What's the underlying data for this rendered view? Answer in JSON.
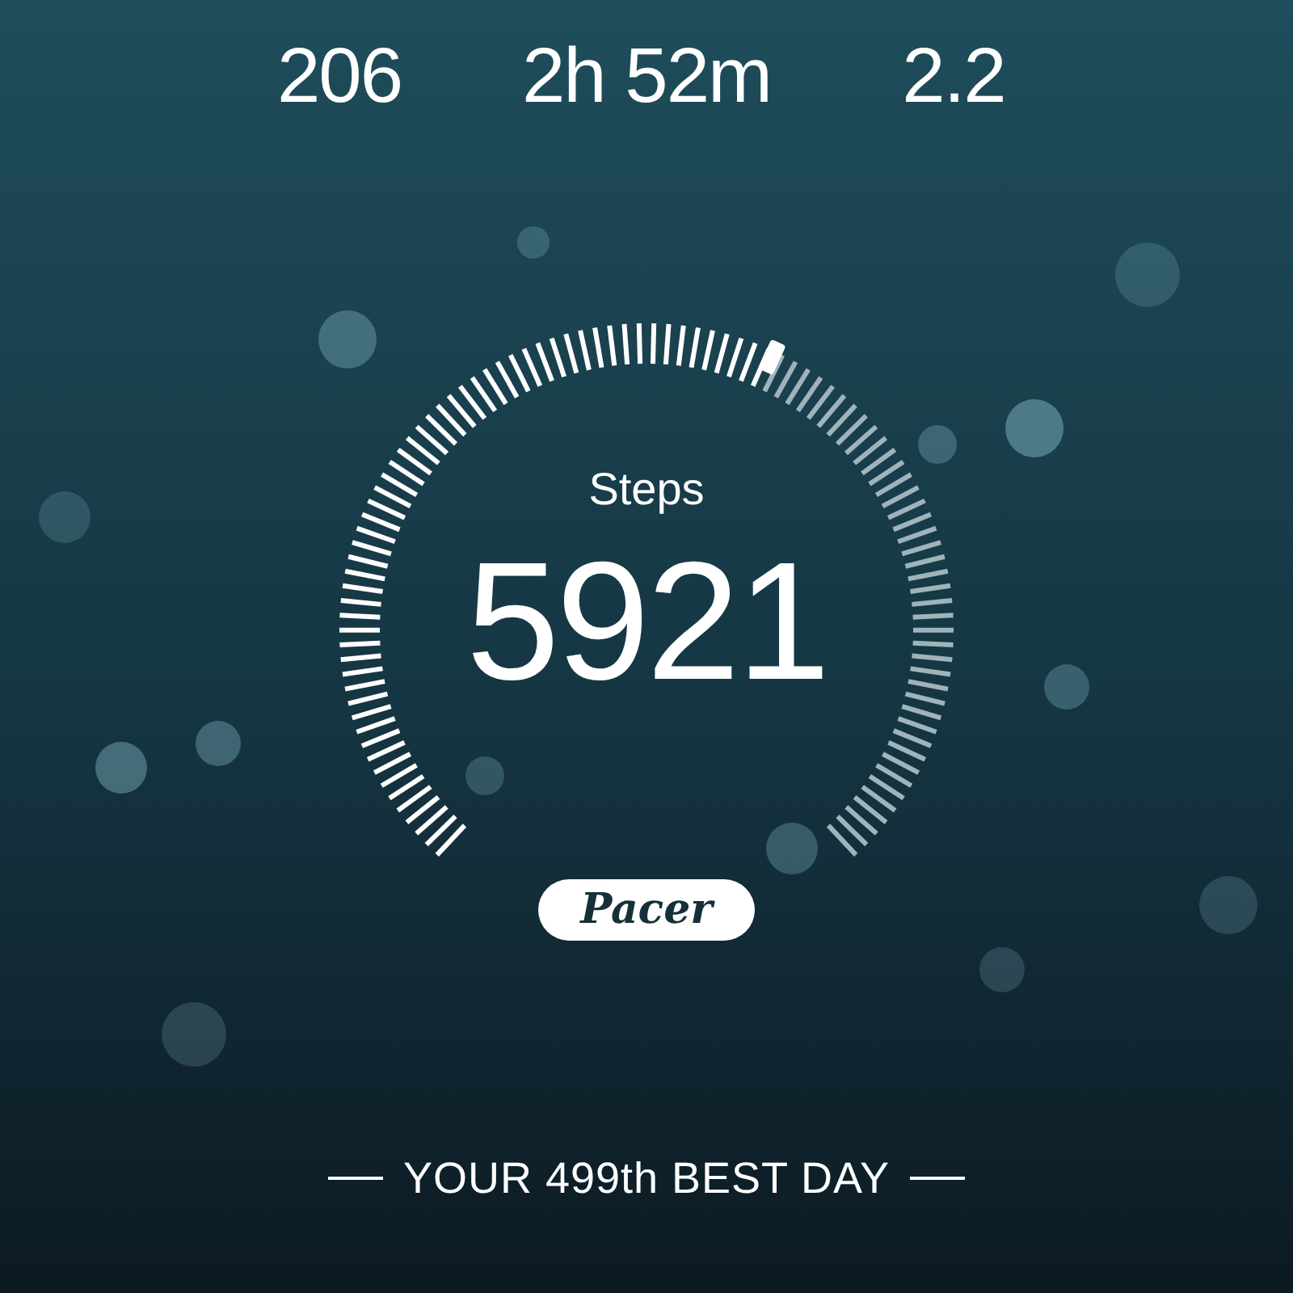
{
  "stats": [
    {
      "value": "206"
    },
    {
      "value": "2h 52m"
    },
    {
      "value": "2.2"
    }
  ],
  "steps": {
    "label": "Steps",
    "value": "5921"
  },
  "logo": {
    "text": "Pacer"
  },
  "rank": {
    "text": "YOUR 499th BEST DAY"
  }
}
